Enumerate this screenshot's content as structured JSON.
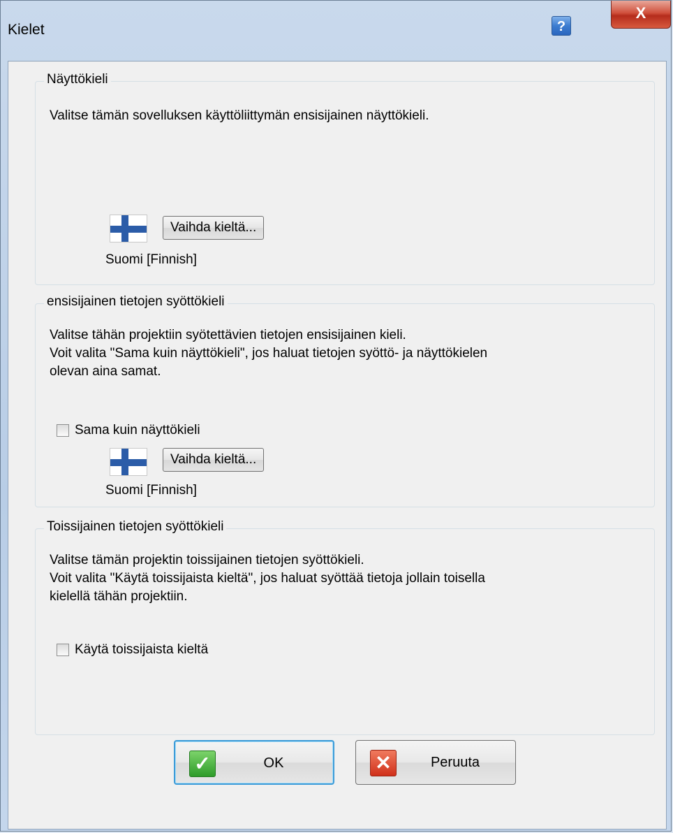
{
  "window": {
    "title": "Kielet",
    "help_label": "?",
    "close_label": "X"
  },
  "display_language": {
    "title": "Näyttökieli",
    "description": "Valitse tämän sovelluksen käyttöliittymän ensisijainen näyttökieli.",
    "change_button": "Vaihda kieltä...",
    "current_language": "Suomi [Finnish]",
    "flag_icon": "finland-flag-icon"
  },
  "primary_input_language": {
    "title": "ensisijainen tietojen syöttökieli",
    "description_lines": [
      "Valitse tähän projektiin syötettävien tietojen ensisijainen kieli.",
      "Voit valita \"Sama kuin näyttökieli\", jos haluat tietojen syöttö- ja näyttökielen",
      "olevan aina samat."
    ],
    "checkbox_label": "Sama kuin näyttökieli",
    "checkbox_checked": false,
    "change_button": "Vaihda kieltä...",
    "current_language": "Suomi [Finnish]",
    "flag_icon": "finland-flag-icon"
  },
  "secondary_input_language": {
    "title": "Toissijainen tietojen syöttökieli",
    "description_lines": [
      "Valitse tämän projektin toissijainen tietojen syöttökieli.",
      "Voit valita \"Käytä toissijaista kieltä\", jos haluat syöttää tietoja jollain toisella",
      "kielellä tähän projektiin."
    ],
    "checkbox_label": "Käytä toissijaista kieltä",
    "checkbox_checked": false
  },
  "footer": {
    "ok_label": "OK",
    "ok_icon": "checkmark-icon",
    "cancel_label": "Peruuta",
    "cancel_icon": "x-icon"
  }
}
